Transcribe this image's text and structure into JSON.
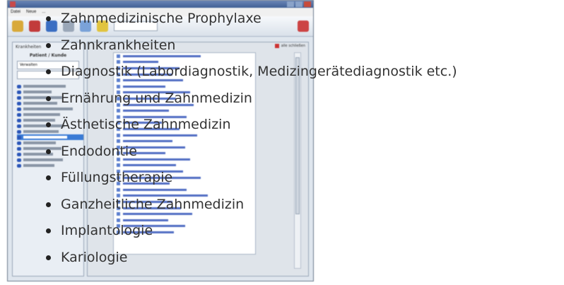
{
  "bullet_list": {
    "items": [
      "Zahnmedizinische Prophylaxe",
      "Zahnkrankheiten",
      "Diagnostik (Labordiagnostik, Medizingerätediagnostik etc.)",
      "Ernährung und Zahnmedizin",
      "Ästhetische Zahnmedizin",
      "Endodontie",
      "Füllungstherapie",
      "Ganzheitliche Zahnmedizin",
      "Implantologie",
      "Kariologie"
    ]
  },
  "background_window": {
    "menu": [
      "Datei",
      "Neue",
      "..."
    ],
    "left_panel": {
      "header": "Krankheiten",
      "patient_label": "Patient / Kunde",
      "button_label": "Verwalten"
    },
    "main_panel": {
      "header_action": "alle schließen"
    }
  },
  "colors": {
    "text": "#333333",
    "bullet": "#222222",
    "link": "#3253b8",
    "selection": "#3a7bd5"
  }
}
